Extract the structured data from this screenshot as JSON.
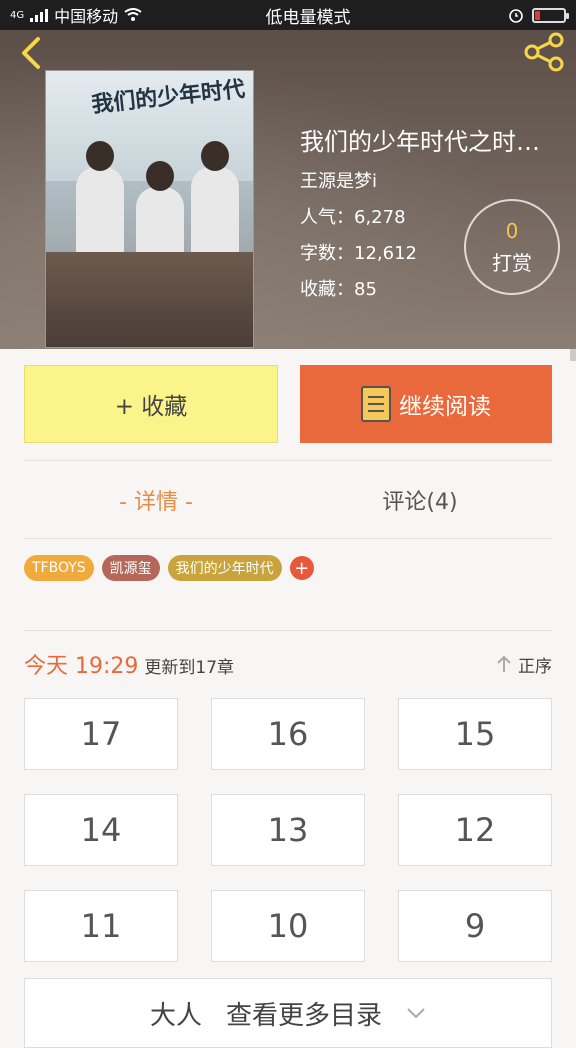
{
  "status_bar": {
    "network": "4G",
    "carrier": "中国移动",
    "mode": "低电量模式",
    "battery_level": 0.18
  },
  "book": {
    "cover_text": "我们的少年时代",
    "title": "我们的少年时代之时…",
    "author": "王源是梦i",
    "popularity": "人气：6,278",
    "word_count": "字数：12,612",
    "favorites": "收藏：85"
  },
  "tip": {
    "count": "0",
    "label": "打赏"
  },
  "actions": {
    "favorite_label": "+ 收藏",
    "read_label": "继续阅读"
  },
  "tabs": [
    {
      "label": "- 详情 -",
      "active": true
    },
    {
      "label": "评论(4)",
      "active": false
    }
  ],
  "tags": [
    {
      "label": "TFBOYS",
      "color": "#f2a93b"
    },
    {
      "label": "凯源玺",
      "color": "#b5675a"
    },
    {
      "label": "我们的少年时代",
      "color": "#c9a43d"
    }
  ],
  "tag_add_label": "+",
  "update": {
    "time": "今天 19:29",
    "text": "更新到17章",
    "sort_label": "正序"
  },
  "chapters": [
    "17",
    "16",
    "15",
    "14",
    "13",
    "12",
    "11",
    "10",
    "9"
  ],
  "more": {
    "prefix": "大人",
    "label": "查看更多目录"
  },
  "colors": {
    "accent": "#e9693c",
    "favorite_bg": "#fbf48b",
    "tab_active": "#e98a43"
  }
}
